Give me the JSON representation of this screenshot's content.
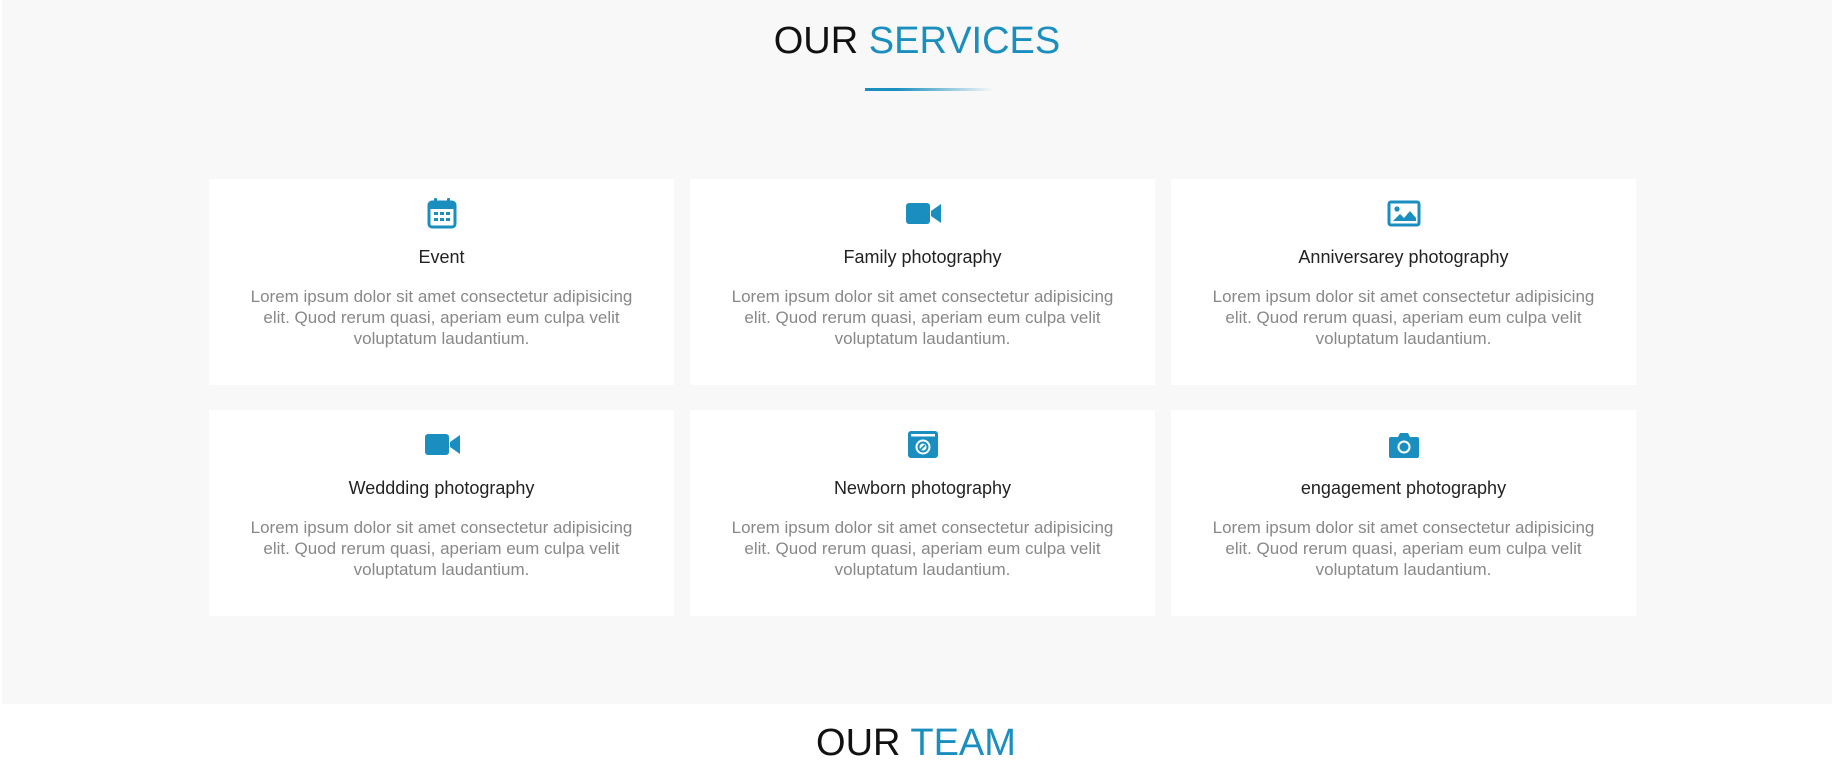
{
  "services": {
    "title_part1": "OUR",
    "title_part2": "SERVICES",
    "cards": [
      {
        "icon": "calendar-icon",
        "title": "Event",
        "text": "Lorem ipsum dolor sit amet consectetur adipisicing elit. Quod rerum quasi, aperiam eum culpa velit voluptatum laudantium."
      },
      {
        "icon": "video-camera-icon",
        "title": "Family photography",
        "text": "Lorem ipsum dolor sit amet consectetur adipisicing elit. Quod rerum quasi, aperiam eum culpa velit voluptatum laudantium."
      },
      {
        "icon": "image-icon",
        "title": "Anniversarey photography",
        "text": "Lorem ipsum dolor sit amet consectetur adipisicing elit. Quod rerum quasi, aperiam eum culpa velit voluptatum laudantium."
      },
      {
        "icon": "video-camera-icon",
        "title": "Weddding photography",
        "text": "Lorem ipsum dolor sit amet consectetur adipisicing elit. Quod rerum quasi, aperiam eum culpa velit voluptatum laudantium."
      },
      {
        "icon": "camera-retro-icon",
        "title": "Newborn photography",
        "text": "Lorem ipsum dolor sit amet consectetur adipisicing elit. Quod rerum quasi, aperiam eum culpa velit voluptatum laudantium."
      },
      {
        "icon": "camera-icon",
        "title": "engagement photography",
        "text": "Lorem ipsum dolor sit amet consectetur adipisicing elit. Quod rerum quasi, aperiam eum culpa velit voluptatum laudantium."
      }
    ]
  },
  "team": {
    "title_part1": "OUR",
    "title_part2": "TEAM"
  },
  "colors": {
    "accent": "#1a8fbf",
    "section_bg": "#f8f8f8",
    "card_bg": "#ffffff",
    "body_text": "#888888"
  }
}
